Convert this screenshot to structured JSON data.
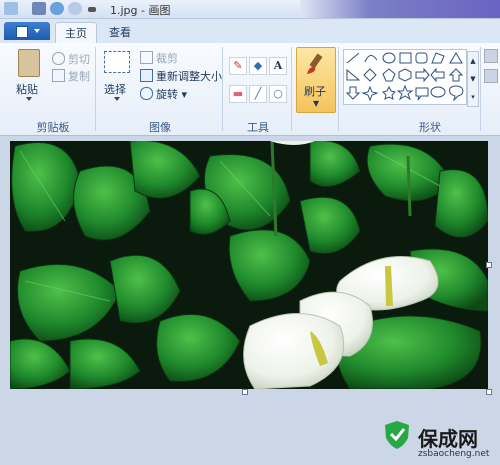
{
  "window": {
    "title": "1.jpg - 画图"
  },
  "tabs": [
    {
      "label": "主页"
    },
    {
      "label": "查看"
    }
  ],
  "clipboard": {
    "paste": "粘贴",
    "cut": "剪切",
    "copy": "复制",
    "group": "剪贴板"
  },
  "image": {
    "select": "选择",
    "crop": "裁剪",
    "resize": "重新调整大小",
    "rotate": "旋转",
    "group": "图像"
  },
  "tools": {
    "group": "工具",
    "text_glyph": "A"
  },
  "brushes": {
    "label": "刷子"
  },
  "shapes": {
    "group": "形状"
  },
  "watermark": {
    "title": "保成网",
    "url": "zsbaocheng.net"
  },
  "colors": {
    "accent": "#1f5bb0",
    "brush_active": "#f6c35a",
    "shield": "#27a844"
  }
}
